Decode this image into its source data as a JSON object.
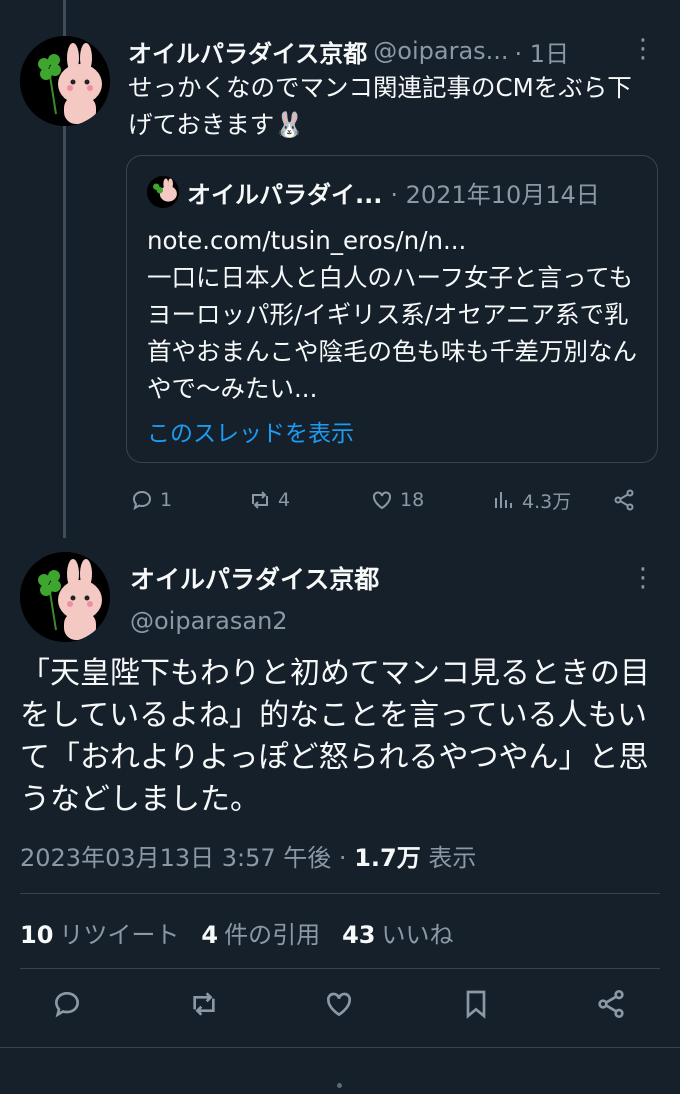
{
  "tweet1": {
    "name": "オイルパラダイス京都",
    "handle": "@oiparas...",
    "time": "· 1日",
    "text": "せっかくなのでマンコ関連記事のCMをぶら下げておきます🐰",
    "quote": {
      "name": "オイルパラダイ...",
      "date": "· 2021年10月14日",
      "text": "note.com/tusin_eros/n/n...\n一口に日本人と白人のハーフ女子と言ってもヨーロッパ形/イギリス系/オセアニア系で乳首やおまんこや陰毛の色も味も千差万別なんやで〜みたい...",
      "thread_link": "このスレッドを表示"
    },
    "actions": {
      "replies": "1",
      "retweets": "4",
      "likes": "18",
      "views": "4.3万"
    }
  },
  "tweet2": {
    "name": "オイルパラダイス京都",
    "handle": "@oiparasan2",
    "text": "「天皇陛下もわりと初めてマンコ見るときの目をしているよね」的なことを言っている人もいて「おれよりよっぽど怒られるやつやん」と思うなどしました。",
    "datetime": "2023年03月13日 3:57 午後 · ",
    "views_count": "1.7万",
    "views_label": " 表示",
    "retweets_count": "10",
    "retweets_label": "リツイート",
    "quotes_count": "4",
    "quotes_label": "件の引用",
    "likes_count": "43",
    "likes_label": "いいね"
  },
  "icons": [
    "reply-icon",
    "retweet-icon",
    "like-icon",
    "views-icon",
    "share-icon",
    "bookmark-icon",
    "more-icon"
  ]
}
